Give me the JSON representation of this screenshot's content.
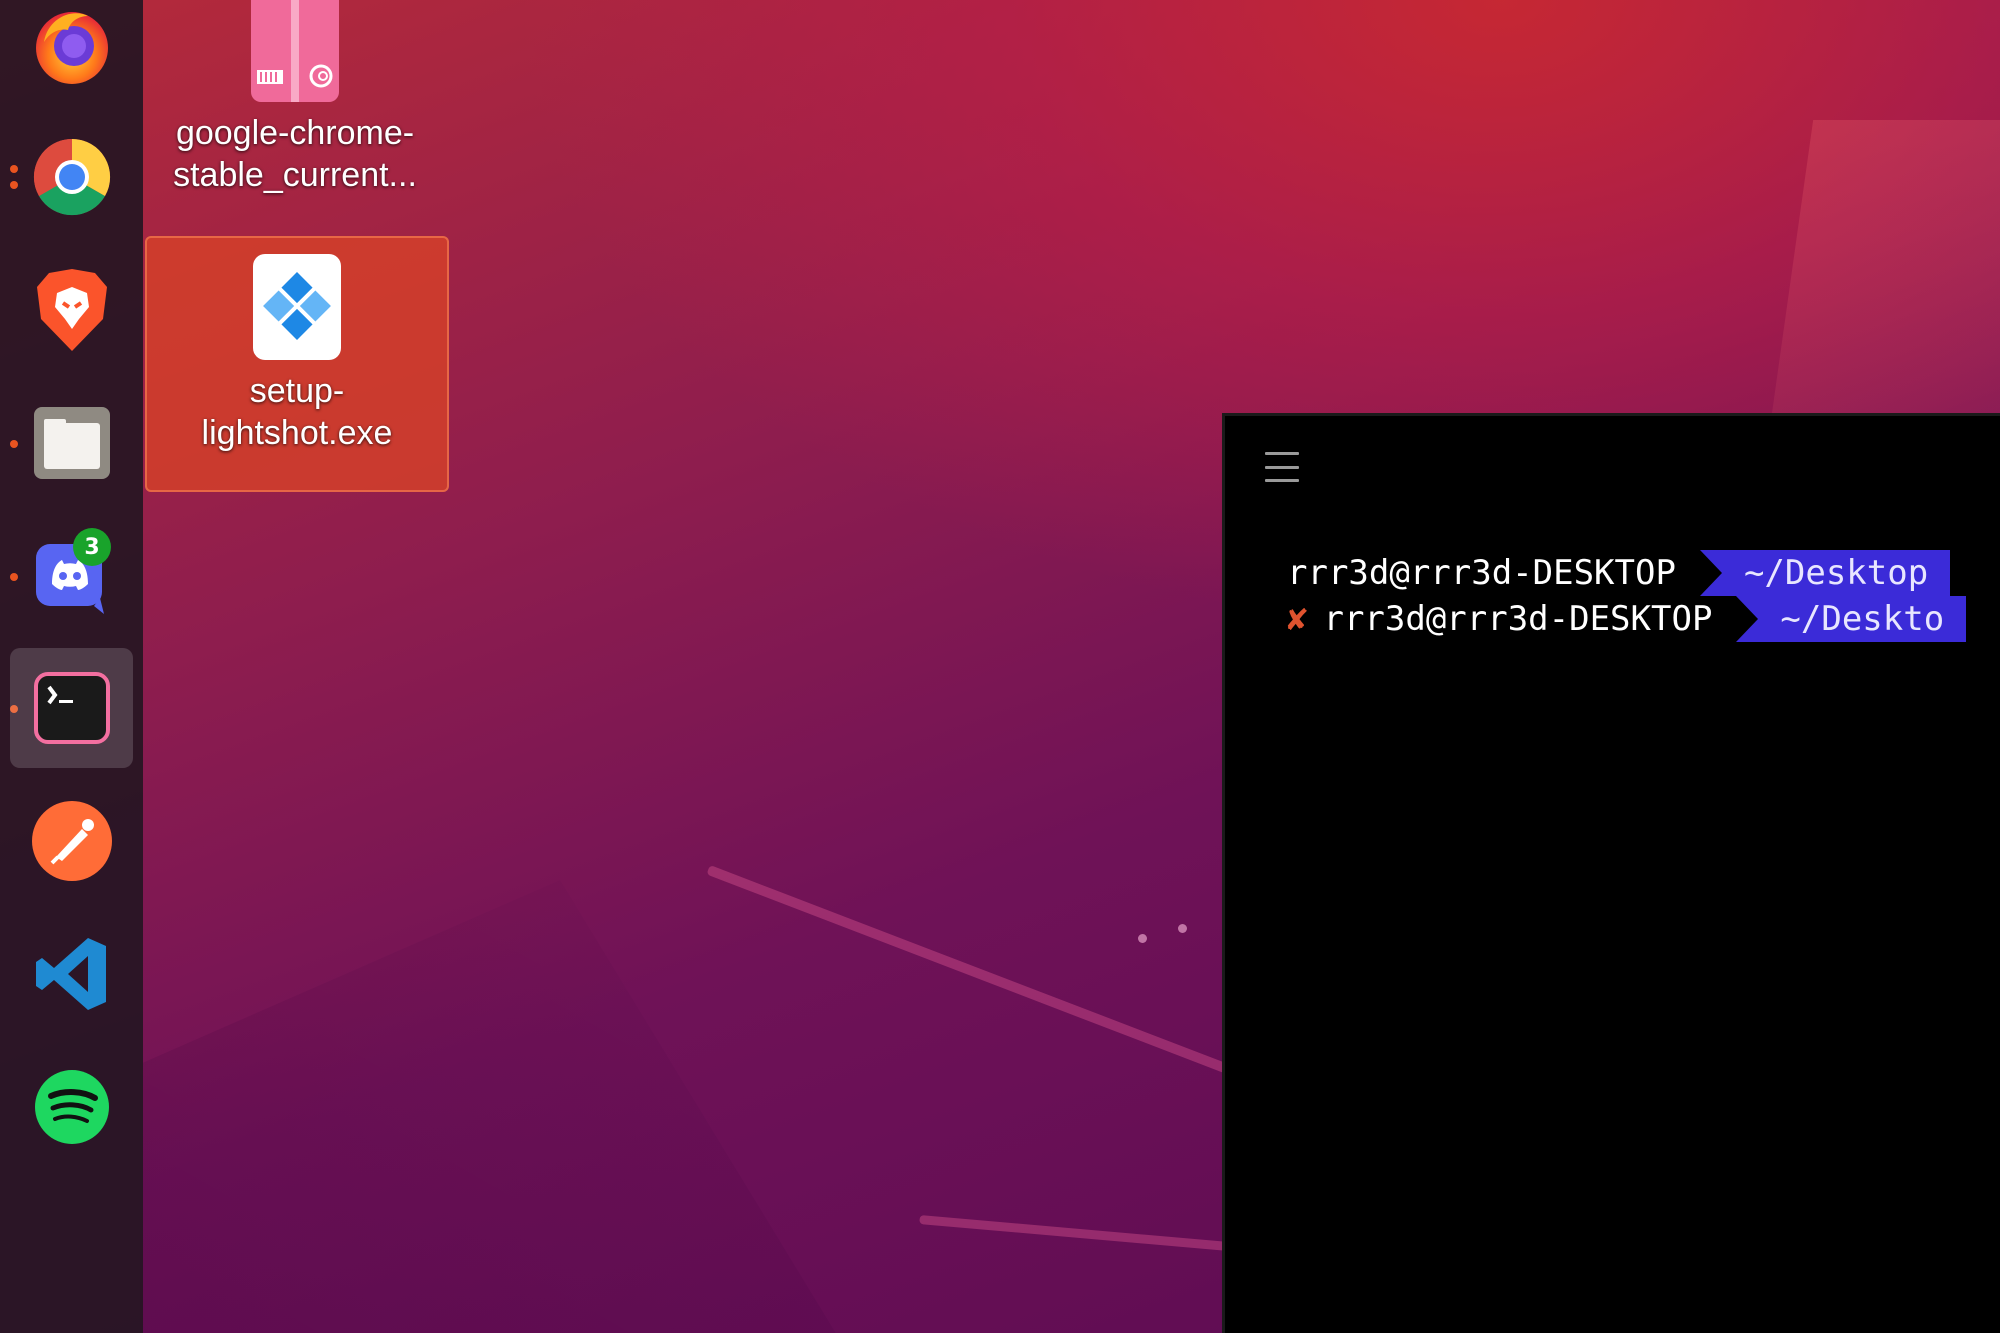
{
  "dock": {
    "items": [
      {
        "name": "firefox",
        "running": false
      },
      {
        "name": "google-chrome",
        "running": true
      },
      {
        "name": "brave-browser",
        "running": false
      },
      {
        "name": "files",
        "running": true
      },
      {
        "name": "discord",
        "running": true,
        "badge": "3"
      },
      {
        "name": "terminal",
        "running": true,
        "active": true
      },
      {
        "name": "postman",
        "running": false
      },
      {
        "name": "visual-studio-code",
        "running": false
      },
      {
        "name": "spotify",
        "running": false
      }
    ]
  },
  "desktop": {
    "icons": [
      {
        "label_line1": "google-chrome-",
        "label_line2": "stable_current...",
        "icon": "debian-package-icon"
      },
      {
        "label_line1": "setup-",
        "label_line2": "lightshot.exe",
        "icon": "exe-installer-icon",
        "selected": true
      }
    ]
  },
  "terminal": {
    "lines": [
      {
        "user_host": "rrr3d@rrr3d-DESKTOP",
        "path": "~/Desktop",
        "error": false
      },
      {
        "status_symbol": "✘",
        "user_host": "rrr3d@rrr3d-DESKTOP",
        "path": "~/Deskto",
        "error": true
      }
    ]
  },
  "colors": {
    "accent": "#e95420",
    "prompt_segment": "#3b2bd8",
    "error_mark": "#e0532f",
    "selection": "#d74128"
  }
}
